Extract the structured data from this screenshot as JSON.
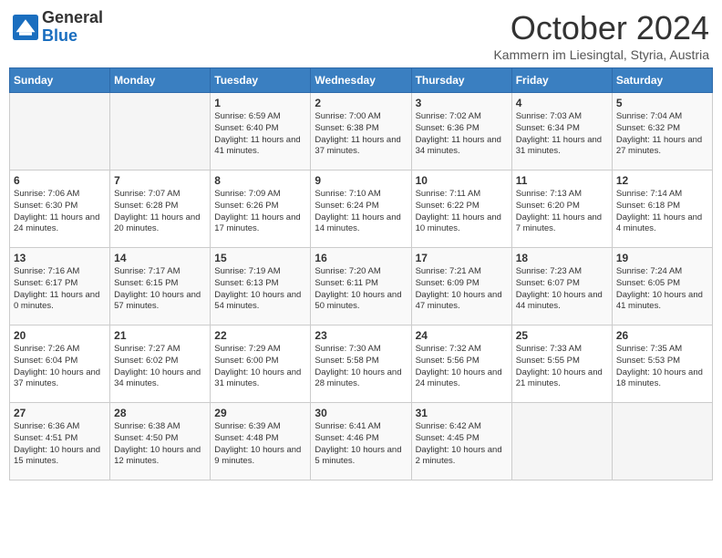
{
  "header": {
    "logo_general": "General",
    "logo_blue": "Blue",
    "month_title": "October 2024",
    "subtitle": "Kammern im Liesingtal, Styria, Austria"
  },
  "weekdays": [
    "Sunday",
    "Monday",
    "Tuesday",
    "Wednesday",
    "Thursday",
    "Friday",
    "Saturday"
  ],
  "weeks": [
    [
      {
        "day": "",
        "info": ""
      },
      {
        "day": "",
        "info": ""
      },
      {
        "day": "1",
        "info": "Sunrise: 6:59 AM\nSunset: 6:40 PM\nDaylight: 11 hours and 41 minutes."
      },
      {
        "day": "2",
        "info": "Sunrise: 7:00 AM\nSunset: 6:38 PM\nDaylight: 11 hours and 37 minutes."
      },
      {
        "day": "3",
        "info": "Sunrise: 7:02 AM\nSunset: 6:36 PM\nDaylight: 11 hours and 34 minutes."
      },
      {
        "day": "4",
        "info": "Sunrise: 7:03 AM\nSunset: 6:34 PM\nDaylight: 11 hours and 31 minutes."
      },
      {
        "day": "5",
        "info": "Sunrise: 7:04 AM\nSunset: 6:32 PM\nDaylight: 11 hours and 27 minutes."
      }
    ],
    [
      {
        "day": "6",
        "info": "Sunrise: 7:06 AM\nSunset: 6:30 PM\nDaylight: 11 hours and 24 minutes."
      },
      {
        "day": "7",
        "info": "Sunrise: 7:07 AM\nSunset: 6:28 PM\nDaylight: 11 hours and 20 minutes."
      },
      {
        "day": "8",
        "info": "Sunrise: 7:09 AM\nSunset: 6:26 PM\nDaylight: 11 hours and 17 minutes."
      },
      {
        "day": "9",
        "info": "Sunrise: 7:10 AM\nSunset: 6:24 PM\nDaylight: 11 hours and 14 minutes."
      },
      {
        "day": "10",
        "info": "Sunrise: 7:11 AM\nSunset: 6:22 PM\nDaylight: 11 hours and 10 minutes."
      },
      {
        "day": "11",
        "info": "Sunrise: 7:13 AM\nSunset: 6:20 PM\nDaylight: 11 hours and 7 minutes."
      },
      {
        "day": "12",
        "info": "Sunrise: 7:14 AM\nSunset: 6:18 PM\nDaylight: 11 hours and 4 minutes."
      }
    ],
    [
      {
        "day": "13",
        "info": "Sunrise: 7:16 AM\nSunset: 6:17 PM\nDaylight: 11 hours and 0 minutes."
      },
      {
        "day": "14",
        "info": "Sunrise: 7:17 AM\nSunset: 6:15 PM\nDaylight: 10 hours and 57 minutes."
      },
      {
        "day": "15",
        "info": "Sunrise: 7:19 AM\nSunset: 6:13 PM\nDaylight: 10 hours and 54 minutes."
      },
      {
        "day": "16",
        "info": "Sunrise: 7:20 AM\nSunset: 6:11 PM\nDaylight: 10 hours and 50 minutes."
      },
      {
        "day": "17",
        "info": "Sunrise: 7:21 AM\nSunset: 6:09 PM\nDaylight: 10 hours and 47 minutes."
      },
      {
        "day": "18",
        "info": "Sunrise: 7:23 AM\nSunset: 6:07 PM\nDaylight: 10 hours and 44 minutes."
      },
      {
        "day": "19",
        "info": "Sunrise: 7:24 AM\nSunset: 6:05 PM\nDaylight: 10 hours and 41 minutes."
      }
    ],
    [
      {
        "day": "20",
        "info": "Sunrise: 7:26 AM\nSunset: 6:04 PM\nDaylight: 10 hours and 37 minutes."
      },
      {
        "day": "21",
        "info": "Sunrise: 7:27 AM\nSunset: 6:02 PM\nDaylight: 10 hours and 34 minutes."
      },
      {
        "day": "22",
        "info": "Sunrise: 7:29 AM\nSunset: 6:00 PM\nDaylight: 10 hours and 31 minutes."
      },
      {
        "day": "23",
        "info": "Sunrise: 7:30 AM\nSunset: 5:58 PM\nDaylight: 10 hours and 28 minutes."
      },
      {
        "day": "24",
        "info": "Sunrise: 7:32 AM\nSunset: 5:56 PM\nDaylight: 10 hours and 24 minutes."
      },
      {
        "day": "25",
        "info": "Sunrise: 7:33 AM\nSunset: 5:55 PM\nDaylight: 10 hours and 21 minutes."
      },
      {
        "day": "26",
        "info": "Sunrise: 7:35 AM\nSunset: 5:53 PM\nDaylight: 10 hours and 18 minutes."
      }
    ],
    [
      {
        "day": "27",
        "info": "Sunrise: 6:36 AM\nSunset: 4:51 PM\nDaylight: 10 hours and 15 minutes."
      },
      {
        "day": "28",
        "info": "Sunrise: 6:38 AM\nSunset: 4:50 PM\nDaylight: 10 hours and 12 minutes."
      },
      {
        "day": "29",
        "info": "Sunrise: 6:39 AM\nSunset: 4:48 PM\nDaylight: 10 hours and 9 minutes."
      },
      {
        "day": "30",
        "info": "Sunrise: 6:41 AM\nSunset: 4:46 PM\nDaylight: 10 hours and 5 minutes."
      },
      {
        "day": "31",
        "info": "Sunrise: 6:42 AM\nSunset: 4:45 PM\nDaylight: 10 hours and 2 minutes."
      },
      {
        "day": "",
        "info": ""
      },
      {
        "day": "",
        "info": ""
      }
    ]
  ]
}
